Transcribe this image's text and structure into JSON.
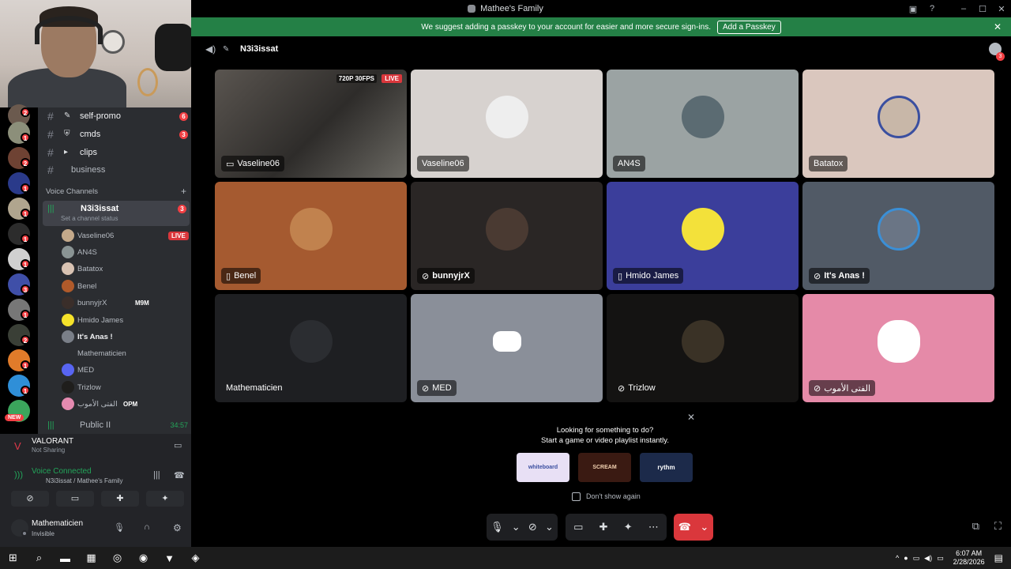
{
  "window": {
    "title": "Mathee's Family"
  },
  "banner": {
    "text": "We suggest adding a passkey to your account for easier and more secure sign-ins.",
    "button": "Add a Passkey"
  },
  "header": {
    "channel": "N3i3issat",
    "notif_count": "3"
  },
  "channels": {
    "self_promo": {
      "label": "self-promo",
      "badge": "6"
    },
    "cmds": {
      "label": "cmds",
      "badge": "3"
    },
    "clips": {
      "label": "clips"
    },
    "business": {
      "label": "business"
    },
    "voice_category": "Voice Channels",
    "active_voice": {
      "label": "N3i3issat",
      "badge": "3",
      "status_hint": "Set a channel status"
    },
    "public": {
      "label": "Public II",
      "timer": "34:57"
    }
  },
  "voice_users": [
    {
      "name": "Vaseline06",
      "live": "LIVE"
    },
    {
      "name": "AN4S"
    },
    {
      "name": "Batatox"
    },
    {
      "name": "Benel"
    },
    {
      "name": "bunnyjrX",
      "tag": "M9M"
    },
    {
      "name": "Hmido James"
    },
    {
      "name": "It's Anas !"
    },
    {
      "name": "Mathematicien"
    },
    {
      "name": "MED"
    },
    {
      "name": "Trizlow"
    },
    {
      "name": "الفتى الأموب",
      "tag": "OPM"
    }
  ],
  "server_badges": [
    "2",
    "1",
    "2",
    "1",
    "1",
    "1",
    "1",
    "3",
    "1",
    "2",
    "1",
    "1",
    "1"
  ],
  "server_new": "NEW",
  "activity": {
    "game": "VALORANT",
    "status": "Not Sharing"
  },
  "voice": {
    "status": "Voice Connected",
    "channel": "N3i3issat / Mathee's Family"
  },
  "user": {
    "name": "Mathematicien",
    "status": "Invisible"
  },
  "tiles": [
    {
      "name": "Vaseline06",
      "quality": "720P 30FPS",
      "live": "LIVE"
    },
    {
      "name": "Vaseline06"
    },
    {
      "name": "AN4S"
    },
    {
      "name": "Batatox"
    },
    {
      "name": "Benel"
    },
    {
      "name": "bunnyjrX"
    },
    {
      "name": "Hmido James"
    },
    {
      "name": "It's Anas !"
    },
    {
      "name": "Mathematicien"
    },
    {
      "name": "MED"
    },
    {
      "name": "Trizlow"
    },
    {
      "name": "الفتى الأموب"
    }
  ],
  "popup": {
    "line1": "Looking for something to do?",
    "line2": "Start a game or video playlist instantly.",
    "option": "Don't show again",
    "apps": [
      "whiteboard",
      "SCREAM",
      "rythm"
    ]
  },
  "taskbar": {
    "time": "6:07 AM",
    "date": "2/28/2026"
  }
}
